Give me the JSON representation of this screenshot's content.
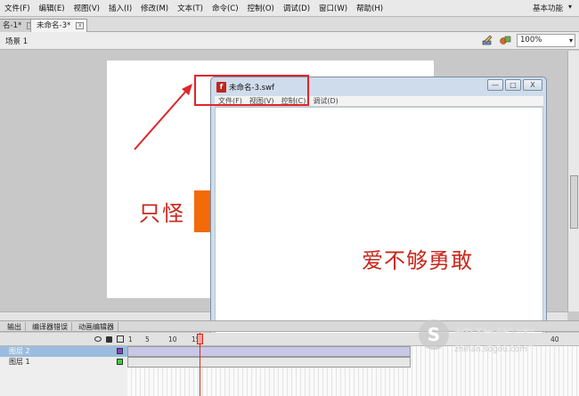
{
  "menubar": {
    "items": [
      "文件(F)",
      "编辑(E)",
      "视图(V)",
      "插入(I)",
      "修改(M)",
      "文本(T)",
      "命令(C)",
      "控制(O)",
      "调试(D)",
      "窗口(W)",
      "帮助(H)"
    ],
    "workspace": "基本功能"
  },
  "tabs": [
    {
      "label": "名-1*"
    },
    {
      "label": "未命名-3*"
    }
  ],
  "scene": {
    "label": "场景 1",
    "zoom": "100%"
  },
  "stage": {
    "text": "只怪"
  },
  "swf_window": {
    "title": "未命名-3.swf",
    "menu": [
      "文件(F)",
      "视图(V)",
      "控制(C)",
      "调试(D)"
    ],
    "text": "爱不够勇敢",
    "buttons": {
      "minimize": "—",
      "restore": "□",
      "close": "X"
    }
  },
  "panels": {
    "tabs": [
      "输出",
      "编译器错误",
      "动画编辑器"
    ]
  },
  "timeline": {
    "frame_numbers": [
      "1",
      "5",
      "10",
      "15",
      "40"
    ],
    "layers": [
      {
        "name": "图层 2",
        "selected": true,
        "color": "#8a3fc9"
      },
      {
        "name": "图层 1",
        "selected": false,
        "color": "#3dcf3d"
      }
    ]
  },
  "watermark": {
    "text": "搜狗指南",
    "url": "zhinan.sogou.com"
  },
  "colors": {
    "accent_red": "#e0252a",
    "stage_text": "#c9271c",
    "orange": "#f36a0a"
  }
}
